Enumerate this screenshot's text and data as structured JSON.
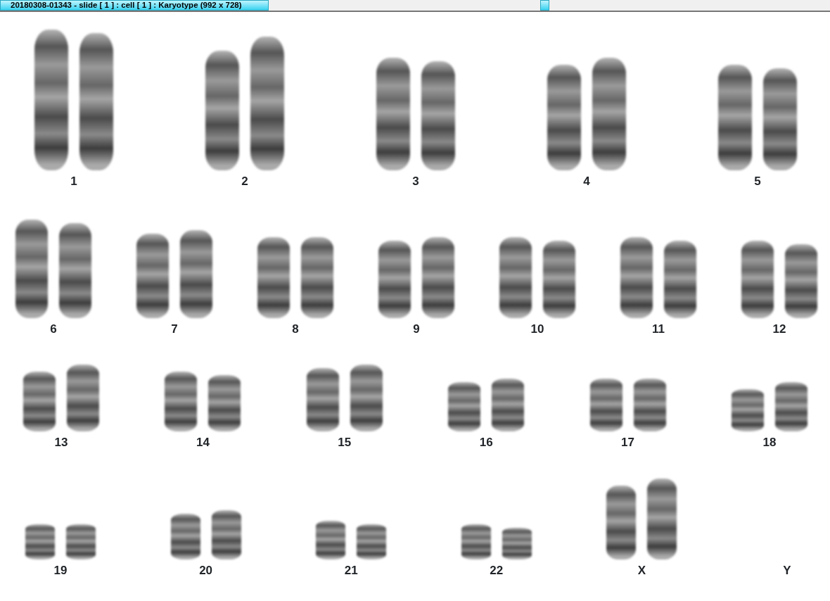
{
  "window": {
    "title": "20180308-01343 - slide [ 1 ] : cell [ 1 ] : Karyotype  (992 x 728)"
  },
  "karyotype": {
    "rows": [
      {
        "pairs": [
          {
            "label": "1",
            "kind": "pair"
          },
          {
            "label": "2",
            "kind": "pair"
          },
          {
            "label": "3",
            "kind": "pair"
          },
          {
            "label": "4",
            "kind": "pair"
          },
          {
            "label": "5",
            "kind": "pair"
          }
        ]
      },
      {
        "pairs": [
          {
            "label": "6",
            "kind": "pair"
          },
          {
            "label": "7",
            "kind": "pair"
          },
          {
            "label": "8",
            "kind": "pair"
          },
          {
            "label": "9",
            "kind": "pair"
          },
          {
            "label": "10",
            "kind": "pair"
          },
          {
            "label": "11",
            "kind": "pair"
          },
          {
            "label": "12",
            "kind": "pair"
          }
        ]
      },
      {
        "pairs": [
          {
            "label": "13",
            "kind": "pair"
          },
          {
            "label": "14",
            "kind": "pair"
          },
          {
            "label": "15",
            "kind": "pair"
          },
          {
            "label": "16",
            "kind": "pair"
          },
          {
            "label": "17",
            "kind": "pair"
          },
          {
            "label": "18",
            "kind": "pair"
          }
        ]
      },
      {
        "pairs": [
          {
            "label": "19",
            "kind": "pair"
          },
          {
            "label": "20",
            "kind": "pair"
          },
          {
            "label": "21",
            "kind": "pair"
          },
          {
            "label": "22",
            "kind": "pair"
          },
          {
            "label": "X",
            "kind": "pair"
          },
          {
            "label": "Y",
            "kind": "empty"
          }
        ]
      }
    ]
  }
}
